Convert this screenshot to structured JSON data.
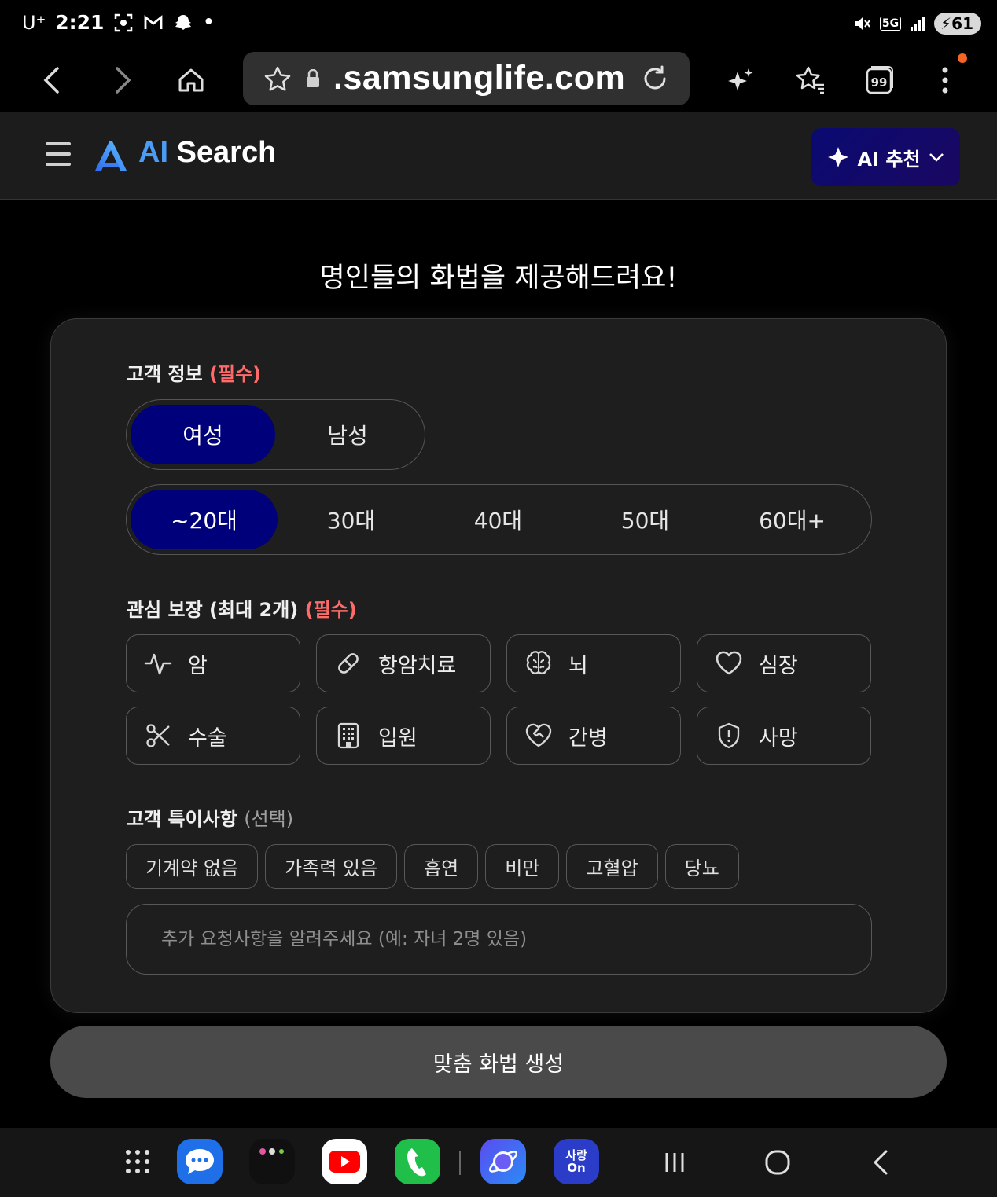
{
  "status_bar": {
    "carrier": "U⁺",
    "time": "2:21",
    "network": "5G",
    "battery": "61"
  },
  "browser": {
    "url": ".samsunglife.com",
    "icons": [
      "back-icon",
      "forward-icon",
      "home-icon",
      "bookmark-star-icon",
      "lock-icon",
      "reload-icon",
      "ai-sparkle-icon",
      "favorites-icon",
      "tabs-icon",
      "more-icon"
    ],
    "tabs_count": "99"
  },
  "header": {
    "brand_ai": "AI",
    "brand_search": "Search",
    "ai_recommend_label": "AI 추천"
  },
  "main": {
    "headline": "명인들의 화법을 제공해드려요!",
    "customer_info": {
      "label": "고객 정보",
      "required": "(필수)",
      "genders": [
        "여성",
        "남성"
      ],
      "selected_gender": "여성",
      "ages": [
        "~20대",
        "30대",
        "40대",
        "50대",
        "60대+"
      ],
      "selected_age": "~20대"
    },
    "coverage": {
      "label": "관심 보장 (최대 2개)",
      "required": "(필수)",
      "items": [
        {
          "label": "암",
          "icon": "pulse-icon"
        },
        {
          "label": "항암치료",
          "icon": "pill-icon"
        },
        {
          "label": "뇌",
          "icon": "brain-icon"
        },
        {
          "label": "심장",
          "icon": "heart-icon"
        },
        {
          "label": "수술",
          "icon": "scissors-icon"
        },
        {
          "label": "입원",
          "icon": "hospital-building-icon"
        },
        {
          "label": "간병",
          "icon": "heart-handshake-icon"
        },
        {
          "label": "사망",
          "icon": "shield-alert-icon"
        }
      ]
    },
    "special_notes": {
      "label": "고객 특이사항",
      "optional": "(선택)",
      "tags": [
        "기계약 없음",
        "가족력 있음",
        "흡연",
        "비만",
        "고혈압",
        "당뇨"
      ],
      "input_placeholder": "추가 요청사항을 알려주세요 (예: 자녀 2명 있음)"
    },
    "generate_label": "맞춤 화법 생성"
  },
  "nav_bar": {
    "apps": [
      "app-drawer-icon",
      "messages-icon",
      "app-folder-icon",
      "youtube-icon",
      "phone-icon",
      "internet-browser-icon",
      "sarang-on-app-icon"
    ],
    "sarang_on_label": "사랑On",
    "system": [
      "recents-icon",
      "home-icon",
      "back-icon"
    ]
  }
}
